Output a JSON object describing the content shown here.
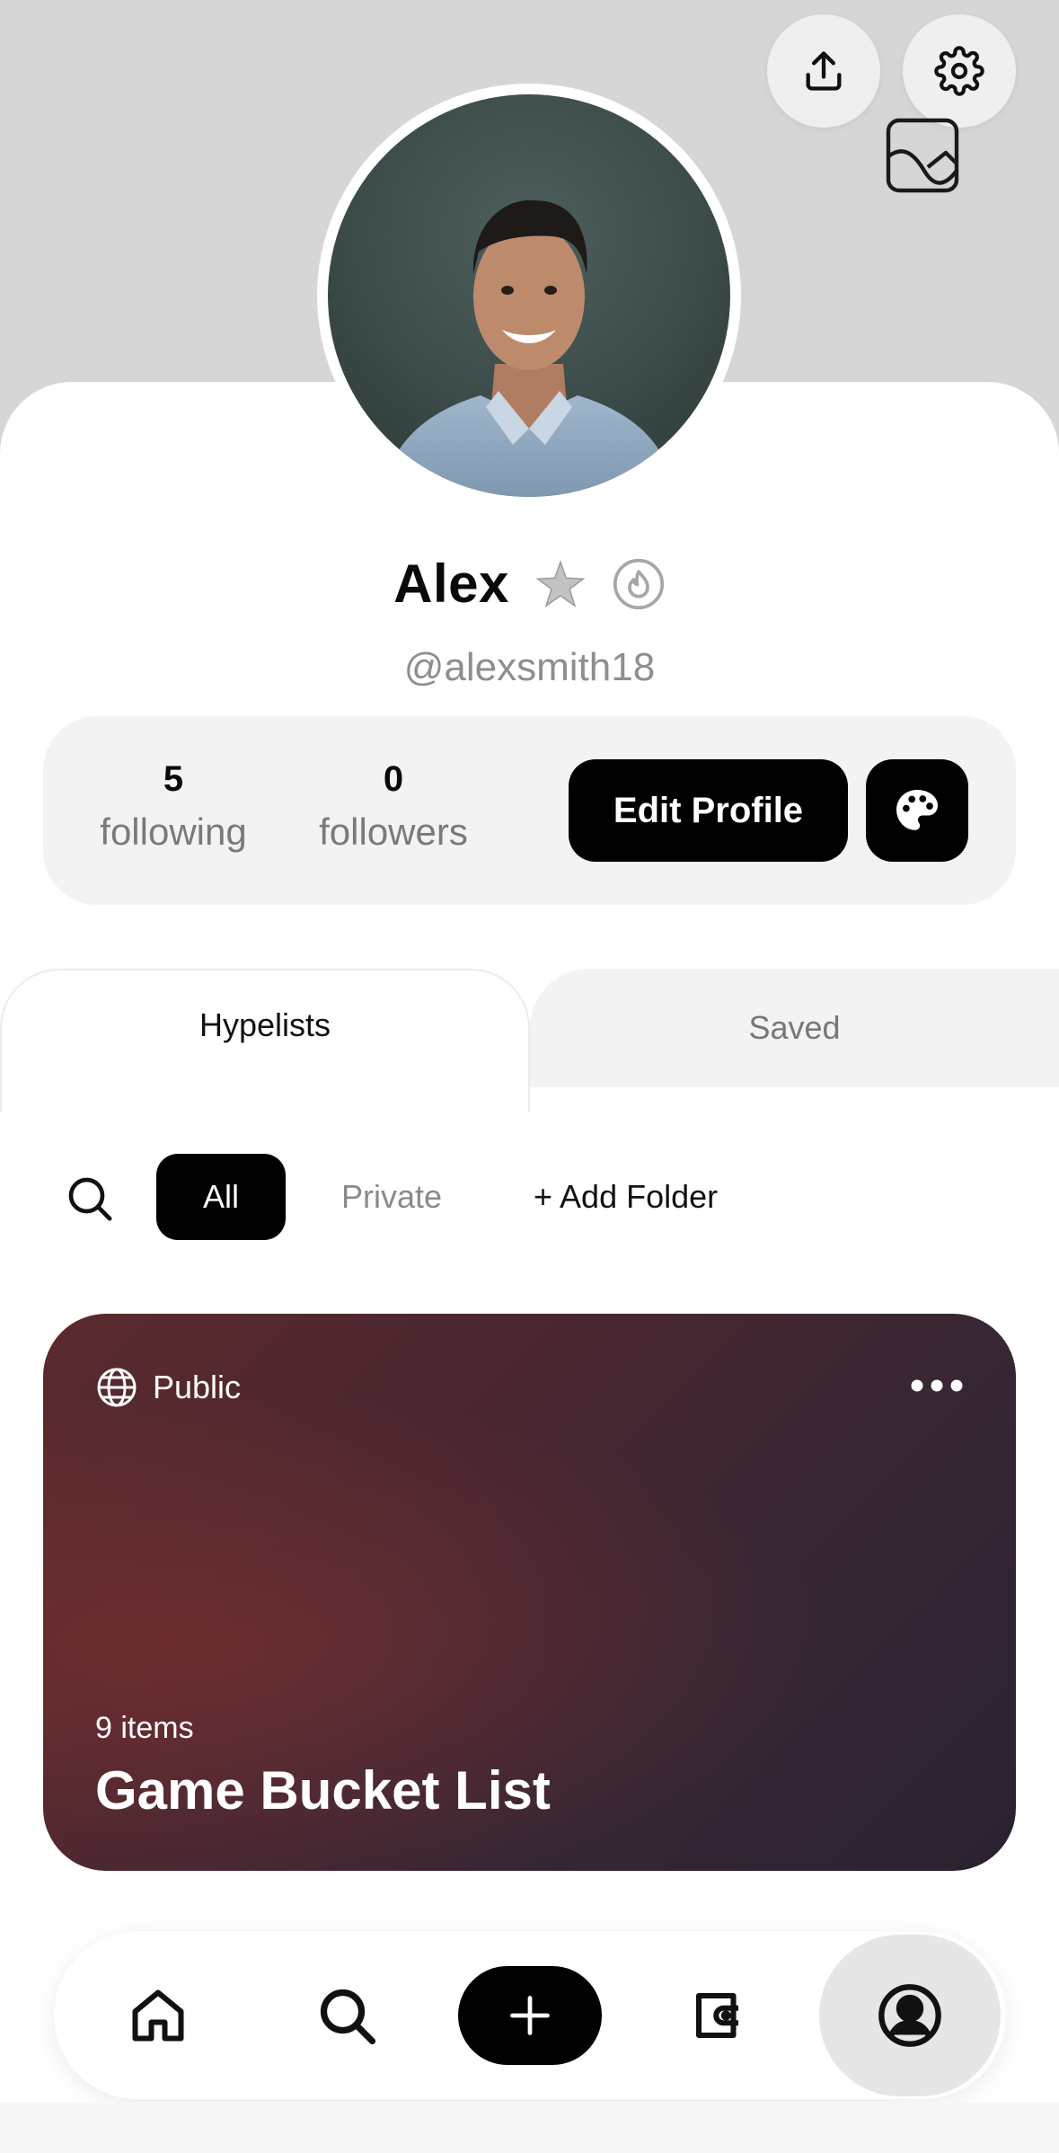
{
  "profile": {
    "name": "Alex",
    "handle": "@alexsmith18",
    "following_count": "5",
    "following_label": "following",
    "followers_count": "0",
    "followers_label": "followers",
    "edit_profile_label": "Edit Profile"
  },
  "header": {
    "share_icon": "share-upload-icon",
    "settings_icon": "gear-icon",
    "cover_icon": "image-icon"
  },
  "tabs": {
    "hypelists": "Hypelists",
    "saved": "Saved",
    "active": "Hypelists"
  },
  "filters": {
    "all": "All",
    "private": "Private",
    "add_folder": "+ Add Folder",
    "selected": "All"
  },
  "card": {
    "visibility": "Public",
    "item_count": "9 items",
    "title": "Game Bucket List"
  },
  "nav": {
    "items": [
      "home-icon",
      "search-icon",
      "add-icon",
      "wallet-icon",
      "profile-icon"
    ],
    "active": "profile-icon"
  },
  "colors": {
    "accent": "#000000",
    "header_bg": "#d6d6d6",
    "card_bg": "#4a2730",
    "muted_text": "#8e8e8e"
  }
}
